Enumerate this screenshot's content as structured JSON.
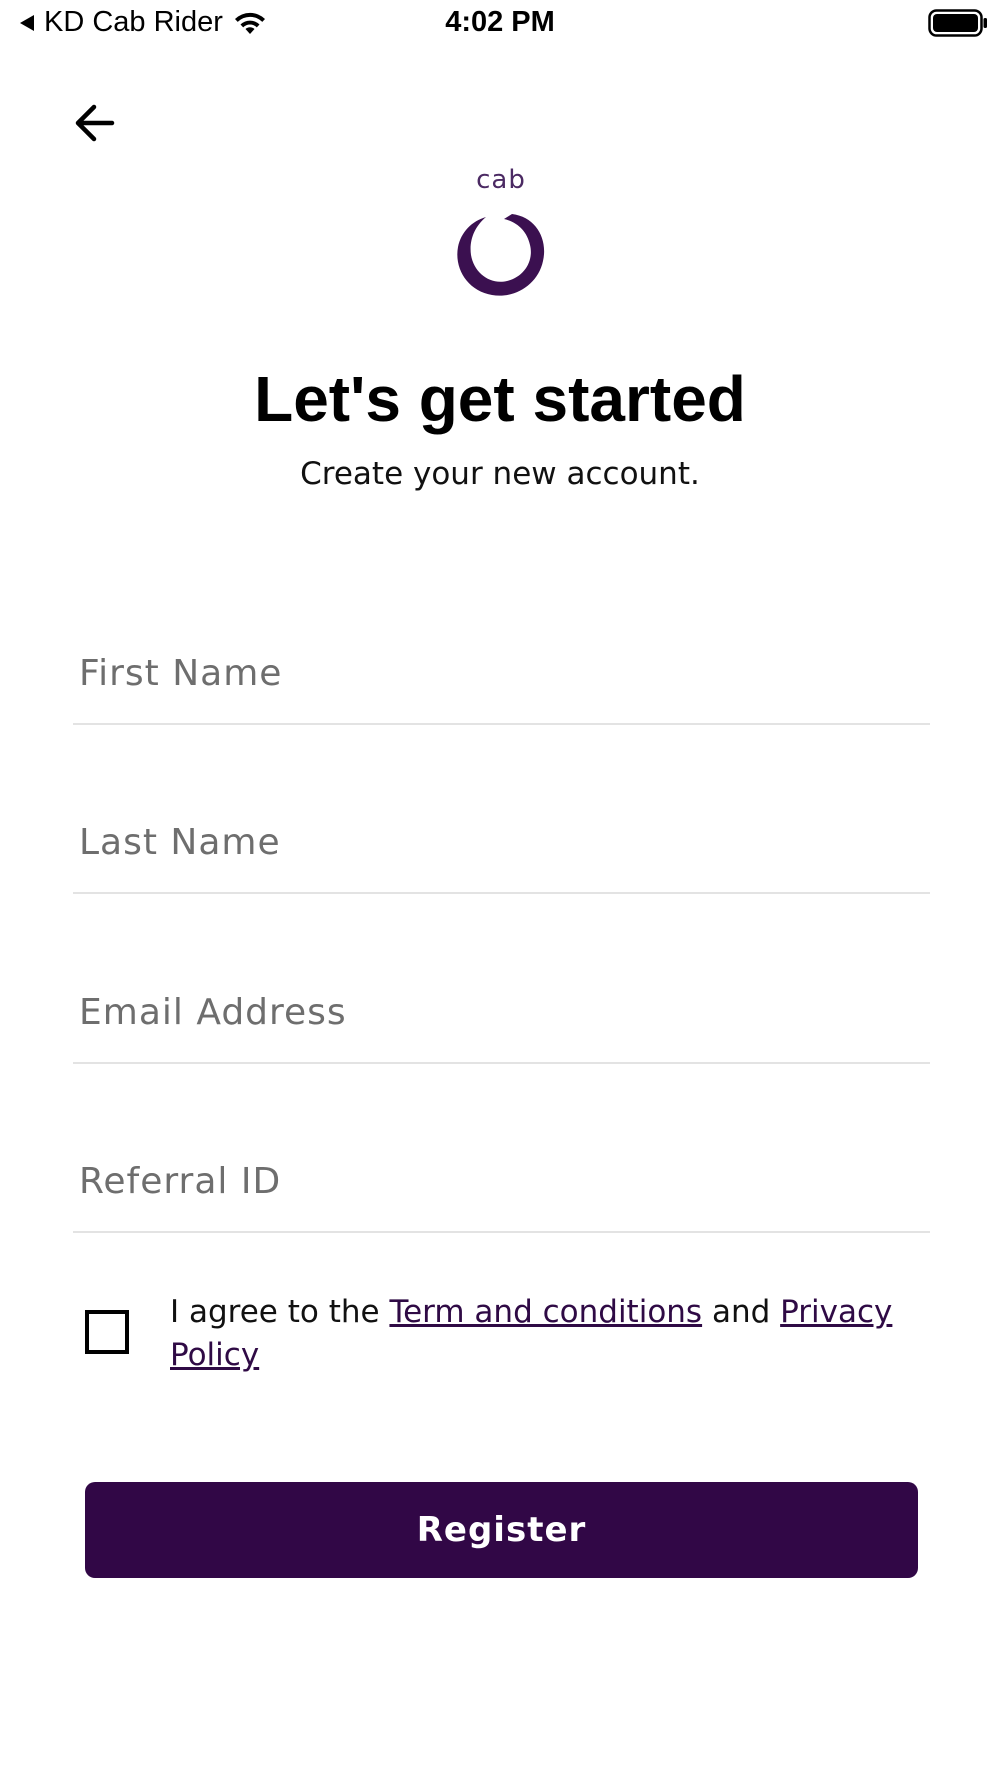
{
  "status_bar": {
    "back_app": "KD Cab Rider",
    "time": "4:02 PM"
  },
  "logo": {
    "text": "cab",
    "color": "#3b1050"
  },
  "header": {
    "title": "Let's get started",
    "subtitle": "Create your new account."
  },
  "form": {
    "first_name_placeholder": "First Name",
    "last_name_placeholder": "Last Name",
    "email_placeholder": "Email Address",
    "referral_placeholder": "Referral ID",
    "first_name_value": "",
    "last_name_value": "",
    "email_value": "",
    "referral_value": ""
  },
  "agreement": {
    "prefix": "I agree to the ",
    "terms_link": "Term and conditions",
    "middle": " and ",
    "privacy_link": "Privacy Policy",
    "checked": false
  },
  "actions": {
    "register_label": "Register"
  },
  "colors": {
    "brand": "#310746",
    "link": "#2f0a45"
  }
}
